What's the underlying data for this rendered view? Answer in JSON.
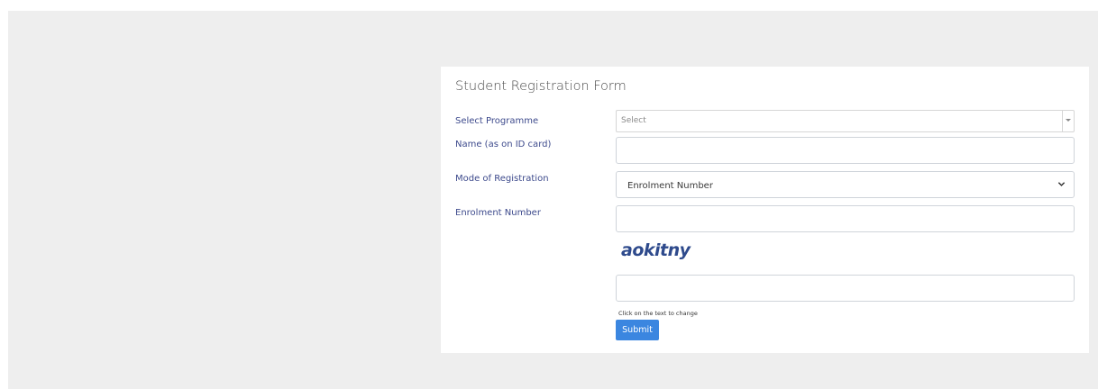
{
  "form": {
    "title": "Student Registration Form",
    "programme": {
      "label": "Select Programme",
      "placeholder": "Select"
    },
    "name": {
      "label": "Name (as on ID card)",
      "value": ""
    },
    "mode": {
      "label": "Mode of Registration",
      "selected": "Enrolment Number"
    },
    "enrolment": {
      "label": "Enrolment Number",
      "value": ""
    },
    "captcha": {
      "text": "aokitny",
      "input_value": "",
      "hint": "Click on the text to change"
    },
    "submit_label": "Submit"
  },
  "colors": {
    "page_background": "#eeeeee",
    "label": "#3d4a8c",
    "submit": "#3b86e0",
    "captcha": "#2e4a8c"
  },
  "icons": {
    "programme_dropdown": "caret-down-icon",
    "mode_dropdown": "chevron-down-icon"
  }
}
